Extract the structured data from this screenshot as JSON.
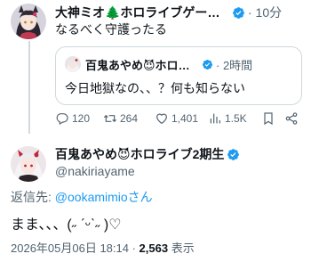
{
  "reply_tweet": {
    "author_name": "大神ミオ🌲ホロライブゲーマ…",
    "time": "· 10分",
    "text": "なるべく守護ったる",
    "quoted": {
      "author_name": "百鬼あやめ😈ホロライ…",
      "time": "· 2時間",
      "text": "今日地獄なの、、？何も知らない"
    },
    "actions": {
      "replies": "120",
      "retweets": "264",
      "likes": "1,401",
      "views": "1.5K"
    }
  },
  "focal_tweet": {
    "author_name": "百鬼あやめ😈ホロライブ2期生",
    "handle": "@nakiriayame",
    "reply_prefix": "返信先: ",
    "reply_target": "@ookamimioさん",
    "text": "まま、、、(˶ ˊᵕˋ˶ )♡",
    "datetime": "2026年05月06日 18:14 · ",
    "view_count": "2,563",
    "view_suffix": " 表示"
  },
  "colors": {
    "text": "#0f1419",
    "secondary": "#536471",
    "link": "#1d9bf0",
    "verified": "#1d9bf0",
    "border": "#cfd9de"
  },
  "icons": [
    "verified-badge-icon",
    "reply-icon",
    "retweet-icon",
    "like-icon",
    "views-icon",
    "bookmark-icon",
    "share-icon"
  ]
}
